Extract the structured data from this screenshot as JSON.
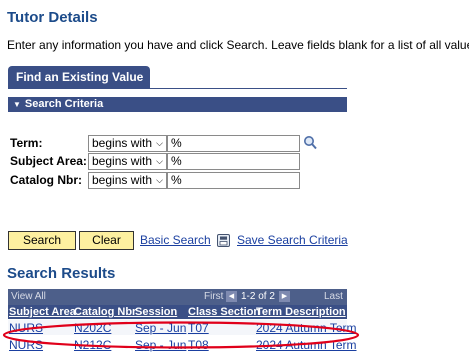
{
  "page": {
    "title": "Tutor Details",
    "instructions": "Enter any information you have and click Search. Leave fields blank for a list of all values."
  },
  "tab": {
    "label": "Find an Existing Value"
  },
  "search_criteria": {
    "header": "Search Criteria",
    "fields": [
      {
        "label": "Term:",
        "operator": "begins with",
        "value": "%"
      },
      {
        "label": "Subject Area:",
        "operator": "begins with",
        "value": "%"
      },
      {
        "label": "Catalog Nbr:",
        "operator": "begins with",
        "value": "%"
      }
    ]
  },
  "actions": {
    "search": "Search",
    "clear": "Clear",
    "basic_search": "Basic Search",
    "save_search": "Save Search Criteria"
  },
  "results": {
    "title": "Search Results",
    "view_all": "View All",
    "first": "First",
    "range": "1-2 of 2",
    "last": "Last",
    "columns": [
      "Subject Area",
      "Catalog Nbr",
      "Session",
      "Class Section",
      "Term Description"
    ],
    "rows": [
      [
        "NURS",
        "N202C",
        "Sep - Jun",
        "T07",
        "2024 Autumn Term"
      ],
      [
        "NURS",
        "N212C",
        "Sep - Jun",
        "T08",
        "2024 Autumn Term"
      ]
    ]
  },
  "colors": {
    "accent": "#3a4f86",
    "title": "#1c4b8a",
    "button": "#fdf0a0",
    "link": "#1a3fa0",
    "annotation": "#e0001a"
  }
}
